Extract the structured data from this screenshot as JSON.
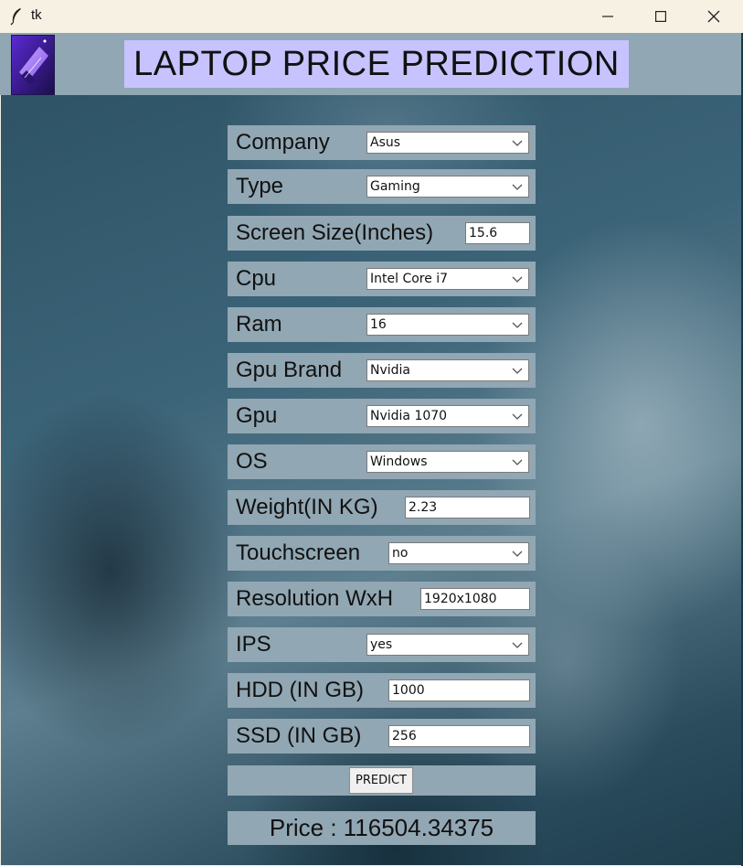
{
  "window": {
    "title": "tk",
    "controls": [
      "minimize-icon",
      "maximize-icon",
      "close-icon"
    ]
  },
  "header": {
    "title": "LAPTOP PRICE PREDICTION",
    "logo_icon": "laptop-logo-icon",
    "title_bg": "#c7c3ff",
    "strip_bg": "#91a7b3"
  },
  "form": {
    "company": {
      "label": "Company",
      "value": "Asus"
    },
    "type": {
      "label": "Type",
      "value": "Gaming"
    },
    "screen_size": {
      "label": "Screen Size(Inches)",
      "value": "15.6"
    },
    "cpu": {
      "label": "Cpu",
      "value": "Intel Core i7"
    },
    "ram": {
      "label": "Ram",
      "value": "16"
    },
    "gpu_brand": {
      "label": "Gpu Brand",
      "value": "Nvidia"
    },
    "gpu": {
      "label": "Gpu",
      "value": "Nvidia 1070"
    },
    "os": {
      "label": "OS",
      "value": "Windows"
    },
    "weight": {
      "label": "Weight(IN KG)",
      "value": "2.23"
    },
    "touchscreen": {
      "label": "Touchscreen",
      "value": "no"
    },
    "resolution": {
      "label": "Resolution WxH",
      "value": "1920x1080"
    },
    "ips": {
      "label": "IPS",
      "value": "yes"
    },
    "hdd": {
      "label": "HDD (IN GB)",
      "value": "1000"
    },
    "ssd": {
      "label": "SSD (IN GB)",
      "value": "256"
    }
  },
  "predict": {
    "label": "PREDICT"
  },
  "result": {
    "text": "Price : 116504.34375"
  }
}
